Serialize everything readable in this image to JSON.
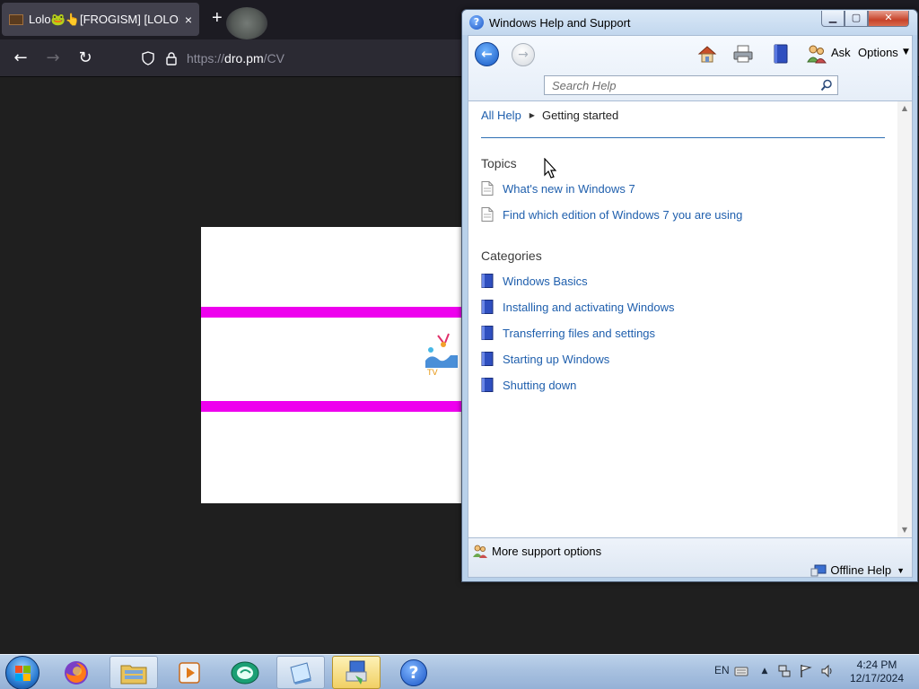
{
  "browser": {
    "tab_title": "Lolo🐸👆[FROGISM] [LOLOISM]",
    "tab_close": "×",
    "new_tab": "+",
    "url_prefix": "https://",
    "url_domain": "dro.pm",
    "url_path": "/CV"
  },
  "help": {
    "title": "Windows Help and Support",
    "toolbar": {
      "ask_label": "Ask",
      "options_label": "Options",
      "search_placeholder": "Search Help"
    },
    "breadcrumb": {
      "root": "All Help",
      "current": "Getting started"
    },
    "topics_heading": "Topics",
    "topics": [
      "What's new in Windows 7",
      "Find which edition of Windows 7 you are using"
    ],
    "categories_heading": "Categories",
    "categories": [
      "Windows Basics",
      "Installing and activating Windows",
      "Transferring files and settings",
      "Starting up Windows",
      "Shutting down"
    ],
    "footer": {
      "more_support": "More support options",
      "offline_help": "Offline Help"
    }
  },
  "taskbar": {
    "language": "EN",
    "time": "4:24 PM",
    "date": "12/17/2024"
  },
  "colors": {
    "link": "#1f5fad",
    "magenta": "#ee00ee",
    "browser_bg": "#1c1b22"
  }
}
